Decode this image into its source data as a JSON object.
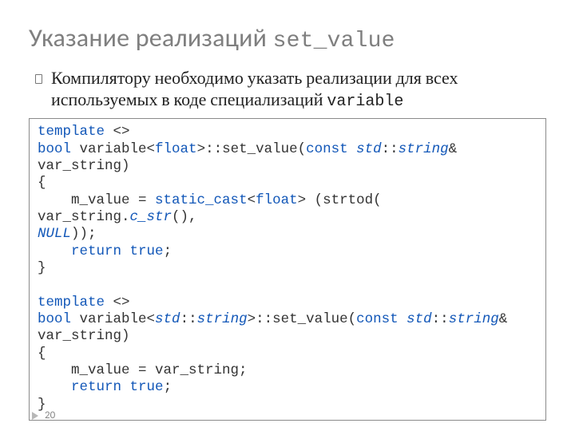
{
  "title_main": "Указание реализаций ",
  "title_mono": "set_value",
  "bullet_pre": "Компилятору необходимо указать реализации для всех используемых в коде специализаций ",
  "bullet_mono": "variable",
  "code": {
    "l1a": "template",
    "l1b": " <>",
    "l2a": "bool",
    "l2b": " variable<",
    "l2c": "float",
    "l2d": ">::set_value(",
    "l2e": "const",
    "l2f": " ",
    "l2g": "std",
    "l2h": "::",
    "l2i": "string",
    "l2j": "& var_string)",
    "l3": "{",
    "l4a": "    m_value = ",
    "l4b": "static_cast",
    "l4c": "<",
    "l4d": "float",
    "l4e": "> (strtod( var_string.",
    "l4f": "c_str",
    "l4g": "(), ",
    "l5a": "NULL",
    "l5b": "));",
    "l6a": "    ",
    "l6b": "return",
    "l6c": " ",
    "l6d": "true",
    "l6e": ";",
    "l7": "}",
    "blank": "",
    "l8a": "template",
    "l8b": " <>",
    "l9a": "bool",
    "l9b": " variable<",
    "l9c": "std",
    "l9d": "::",
    "l9e": "string",
    "l9f": ">::set_value(",
    "l9g": "const",
    "l9h": " ",
    "l9i": "std",
    "l9j": "::",
    "l9k": "string",
    "l9l": "& ",
    "l10": "var_string)",
    "l11": "{",
    "l12": "    m_value = var_string;",
    "l13a": "    ",
    "l13b": "return",
    "l13c": " ",
    "l13d": "true",
    "l13e": ";",
    "l14": "}"
  },
  "page_number": "20"
}
